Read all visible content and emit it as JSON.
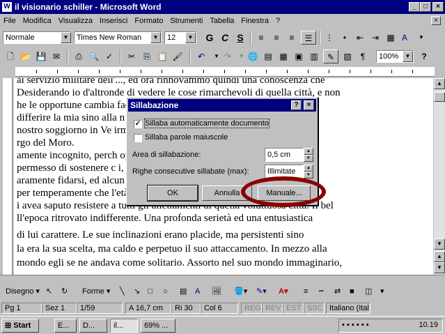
{
  "window": {
    "title": "il visionario schiller - Microsoft Word",
    "app_icon": "W",
    "minimize": "_",
    "maximize": "□",
    "close": "×"
  },
  "menu": [
    "File",
    "Modifica",
    "Visualizza",
    "Inserisci",
    "Formato",
    "Strumenti",
    "Tabella",
    "Finestra",
    "?"
  ],
  "format_toolbar": {
    "style": "Normale",
    "font": "Times New Roman",
    "size": "12",
    "bold": "G",
    "italic": "C",
    "underline": "S"
  },
  "standard_toolbar": {
    "zoom": "100%",
    "help": "?"
  },
  "document": {
    "lines": [
      "al servizio militare dell'..., ed ora rinnovammo quindi una conoscenza che",
      "Desiderando io d'altronde di vedere le cose rimarchevoli di quella città, e non",
      "he le opportune cambia                                         facilmente a",
      "differire la mia sino alla                                     n separarci",
      "nostro soggiorno in Ve                                       irmi il suo",
      "rgo del Moro.",
      "amente incognito, perch                                       oppannaggio",
      "permesso di sostenere c                                      i, della cui",
      "aramente fidarsi, ed alcun                                    egato. Egli",
      "per temperamente che                                          l'età di",
      "i avea saputo resistere a tutti gli allettamenti di quella voluttuosa città. Il bel",
      "ll'epoca ritrovato indifferente. Una profonda serietà ed una entusiastica",
      "di lui carattere. Le sue inclinazioni erano placide, ma persistenti sino",
      "la era la sua scelta, ma caldo e perpetuo il suo attaccamento. In mezzo alla",
      "mondo egli se ne andava come solitario. Assorto nel suo mondo immaginario,"
    ]
  },
  "dialog": {
    "title": "Sillabazione",
    "help_btn": "?",
    "close_btn": "×",
    "auto_hyphenate": "Sillaba automaticamente documento",
    "auto_hyphenate_checked": true,
    "caps": "Sillaba parole maiuscole",
    "caps_checked": false,
    "zone_label": "Area di sillabazione:",
    "zone_value": "0,5 cm",
    "consecutive_label": "Righe consecutive sillabate (max):",
    "consecutive_value": "Illimitate",
    "ok": "OK",
    "cancel": "Annulla",
    "manual": "Manuale..."
  },
  "drawing_toolbar": {
    "draw": "Disegno",
    "autoshapes": "Forme"
  },
  "status": {
    "page": "Pg 1",
    "section": "Sez 1",
    "pages": "1/59",
    "at": "A 16,7 cm",
    "line": "Ri 30",
    "col": "Col 6",
    "rec": "REG",
    "rev": "REV",
    "ext": "EST",
    "ovr": "SSC",
    "lang": "Italiano (Ital"
  },
  "taskbar": {
    "start": "Start",
    "tasks": [
      "E...",
      "D...",
      "il...",
      "69% ..."
    ],
    "clock": "10.19"
  }
}
